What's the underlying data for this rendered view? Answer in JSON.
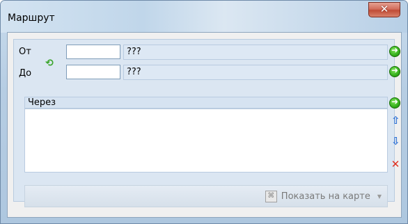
{
  "window": {
    "title": "Маршрут"
  },
  "route": {
    "from_label": "От",
    "to_label": "До",
    "from_value": "???",
    "to_value": "???",
    "via_header": "Через"
  },
  "actions": {
    "show_on_map": "Показать на карте"
  },
  "icons": {
    "go": "green-arrow-right",
    "swap": "swap-arrows",
    "up": "arrow-up",
    "down": "arrow-down",
    "delete": "red-x"
  },
  "colors": {
    "accent_green": "#35b01c",
    "arrow_blue": "#2a6fd6",
    "delete_red": "#e03020"
  }
}
